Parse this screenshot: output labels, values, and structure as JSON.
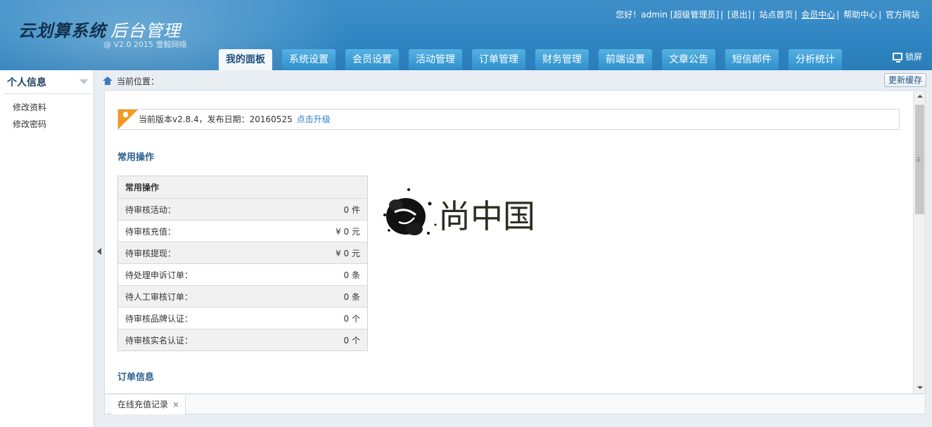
{
  "header": {
    "logo_main": "云划算系统",
    "logo_sub": "后台管理",
    "version": "@ V2.0 2015 雪毅网络",
    "greeting": "您好！admin",
    "role": "[超级管理员]",
    "logout": "[退出]",
    "links": [
      "站点首页",
      "会员中心",
      "帮助中心",
      "官方网站"
    ],
    "lock_label": "锁屏"
  },
  "nav": {
    "tabs": [
      {
        "label": "我的面板",
        "active": true
      },
      {
        "label": "系统设置",
        "active": false
      },
      {
        "label": "会员设置",
        "active": false
      },
      {
        "label": "活动管理",
        "active": false
      },
      {
        "label": "订单管理",
        "active": false
      },
      {
        "label": "财务管理",
        "active": false
      },
      {
        "label": "前端设置",
        "active": false
      },
      {
        "label": "文章公告",
        "active": false
      },
      {
        "label": "短信邮件",
        "active": false
      },
      {
        "label": "分析统计",
        "active": false
      }
    ]
  },
  "sidebar": {
    "title": "个人信息",
    "items": [
      {
        "label": "修改资料"
      },
      {
        "label": "修改密码"
      }
    ]
  },
  "breadcrumb": {
    "label": "当前位置："
  },
  "refresh_button": "更新缓存",
  "notice": {
    "text": "当前版本v2.8.4，发布日期：20160525",
    "link": "点击升级"
  },
  "sections": {
    "common": "常用操作",
    "orders": "订单信息"
  },
  "ops_table": {
    "header": "常用操作",
    "rows": [
      {
        "label": "待审核活动：",
        "value": "0 件"
      },
      {
        "label": "待审核充值：",
        "value": "¥ 0 元"
      },
      {
        "label": "待审核提现：",
        "value": "¥ 0 元"
      },
      {
        "label": "待处理申诉订单：",
        "value": "0 条"
      },
      {
        "label": "待人工审核订单：",
        "value": "0 条"
      },
      {
        "label": "待审核品牌认证：",
        "value": "0 个"
      },
      {
        "label": "待审核实名认证：",
        "value": "0 个"
      }
    ]
  },
  "brand_image": {
    "text": "尚中国"
  },
  "bottom_tab": {
    "label": "在线充值记录",
    "close": "×"
  },
  "colors": {
    "header_blue": "#2f86c2",
    "tab_blue": "#3a9bd5",
    "section_title": "#2a5e8e",
    "notice_orange": "#f19a1f",
    "link_blue": "#2a7fcd"
  }
}
